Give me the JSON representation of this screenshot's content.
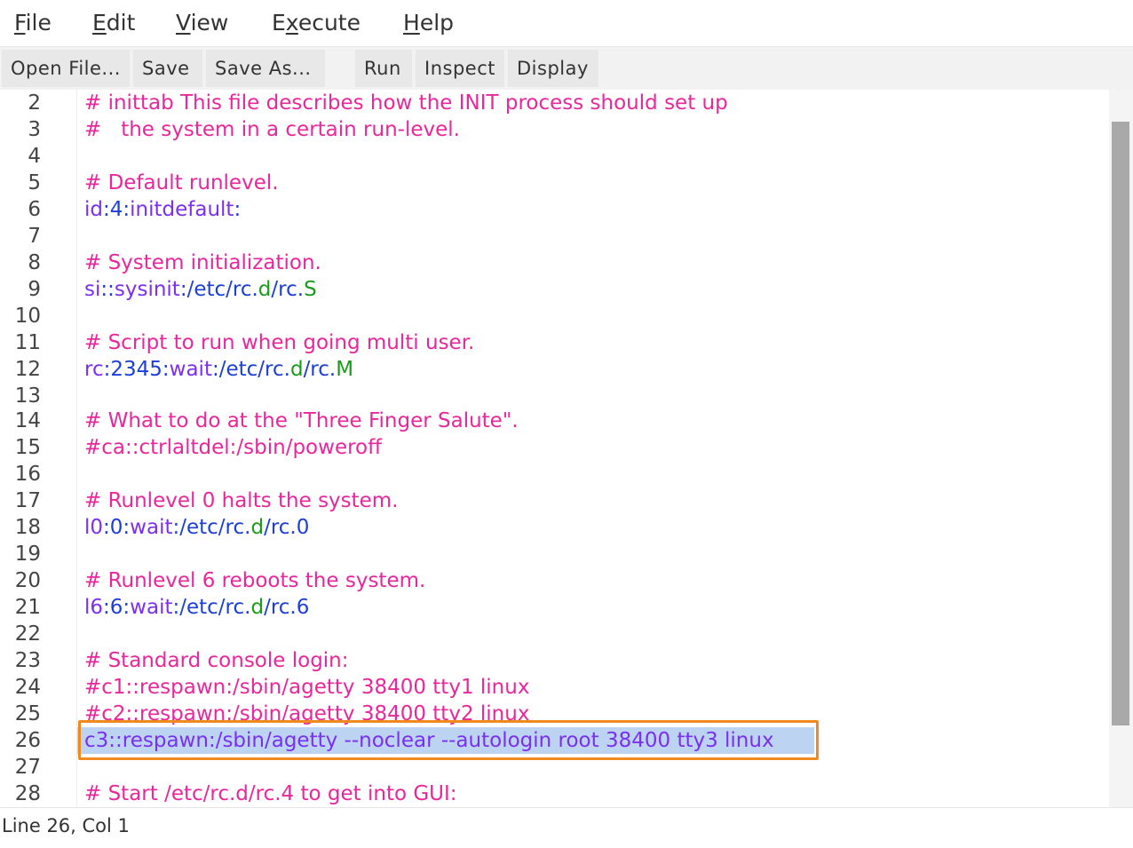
{
  "menubar": {
    "items": [
      {
        "mnemonic": "F",
        "rest": "ile"
      },
      {
        "mnemonic": "E",
        "rest": "dit"
      },
      {
        "mnemonic": "V",
        "rest": "iew"
      },
      {
        "pre": "E",
        "mnemonic": "x",
        "rest": "ecute"
      },
      {
        "mnemonic": "H",
        "rest": "elp"
      }
    ]
  },
  "toolbar": {
    "open_label": "Open File...",
    "save_label": "Save",
    "save_as_label": "Save As...",
    "run_label": "Run",
    "inspect_label": "Inspect",
    "display_label": "Display"
  },
  "editor": {
    "line_numbers": [
      "2",
      "3",
      "4",
      "5",
      "6",
      "7",
      "8",
      "9",
      "10",
      "11",
      "12",
      "13",
      "14",
      "15",
      "16",
      "17",
      "18",
      "19",
      "20",
      "21",
      "22",
      "23",
      "24",
      "25",
      "26",
      "27",
      "28"
    ],
    "lines": {
      "l2": "# inittab This file describes how the INIT process should set up",
      "l3": "#   the system in a certain run-level.",
      "l5": "# Default runlevel.",
      "l6": {
        "a": "id",
        "b": ":",
        "c": "4",
        "d": ":",
        "e": "initdefault",
        "f": ":"
      },
      "l8": "# System initialization.",
      "l9": {
        "a": "si",
        "b": "::",
        "c": "sysinit",
        "d": ":/etc/rc.",
        "e": "d",
        "f": "/rc.",
        "g": "S"
      },
      "l11": "# Script to run when going multi user.",
      "l12": {
        "a": "rc",
        "b": ":",
        "c": "2345",
        "d": ":",
        "e": "wait",
        "f": ":/etc/rc.",
        "g": "d",
        "h": "/rc.",
        "i": "M"
      },
      "l14": "# What to do at the \"Three Finger Salute\".",
      "l15": "#ca::ctrlaltdel:/sbin/poweroff",
      "l17": "# Runlevel 0 halts the system.",
      "l18": {
        "a": "l0",
        "b": ":",
        "c": "0",
        "d": ":",
        "e": "wait",
        "f": ":/etc/rc.",
        "g": "d",
        "h": "/rc.",
        "i": "0"
      },
      "l20": "# Runlevel 6 reboots the system.",
      "l21": {
        "a": "l6",
        "b": ":",
        "c": "6",
        "d": ":",
        "e": "wait",
        "f": ":/etc/rc.",
        "g": "d",
        "h": "/rc.",
        "i": "6"
      },
      "l23": "# Standard console login:",
      "l24": "#c1::respawn:/sbin/agetty 38400 tty1 linux",
      "l25": "#c2::respawn:/sbin/agetty 38400 tty2 linux",
      "l26": "c3::respawn:/sbin/agetty --noclear --autologin root 38400 tty3 linux",
      "l28": "# Start /etc/rc.d/rc.4 to get into GUI:"
    }
  },
  "statusbar": {
    "position": "Line 26, Col 1"
  },
  "colors": {
    "comment": "#e8279c",
    "keyword": "#7b2ff0",
    "path": "#1c3fd6",
    "letter": "#1a9c1a",
    "selection": "#bcd4f2",
    "highlight_box": "#f0891e"
  }
}
